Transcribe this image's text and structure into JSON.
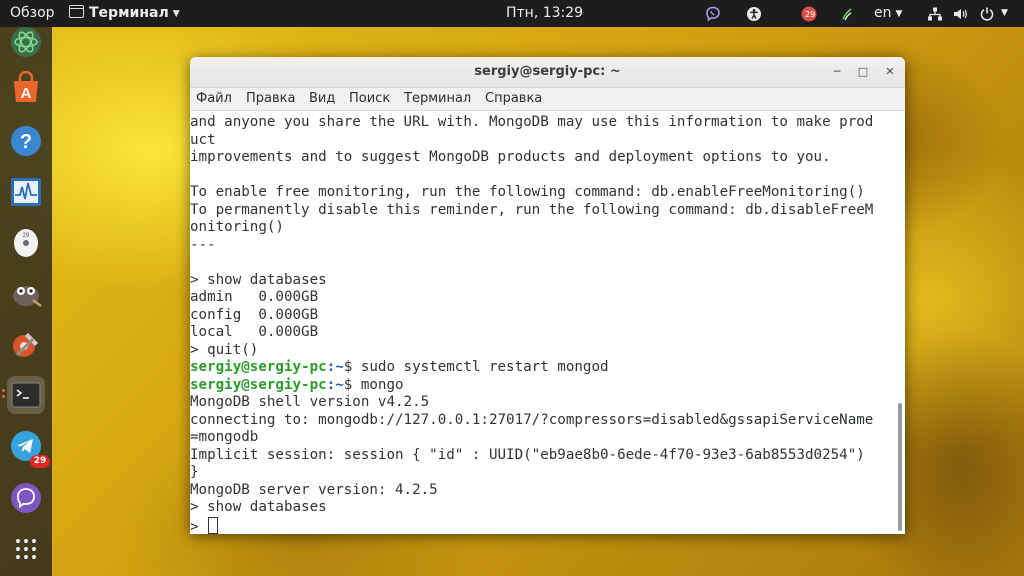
{
  "topbar": {
    "overview": "Обзор",
    "app_menu": "Терминал",
    "clock": "Птн, 13:29",
    "viber_badge": "29",
    "language": "en",
    "icons": [
      "viber-icon",
      "accessibility-icon",
      "telegram-icon",
      "sync-icon",
      "network-icon",
      "volume-icon",
      "power-icon"
    ]
  },
  "dock": {
    "items": [
      "atom-icon",
      "ubuntu-software-icon",
      "help-icon",
      "system-monitor-icon",
      "disk-utility-icon",
      "gimp-icon",
      "settings-icon",
      "terminal-icon",
      "telegram-icon",
      "viber-icon",
      "show-apps-icon"
    ],
    "telegram_badge": "29"
  },
  "window": {
    "title": "sergiy@sergiy-pc: ~",
    "menu": [
      "Файл",
      "Правка",
      "Вид",
      "Поиск",
      "Терминал",
      "Справка"
    ]
  },
  "terminal": {
    "lines": [
      {
        "text": "and anyone you share the URL with. MongoDB may use this information to make prod"
      },
      {
        "text": "uct"
      },
      {
        "text": "improvements and to suggest MongoDB products and deployment options to you."
      },
      {
        "text": ""
      },
      {
        "text": "To enable free monitoring, run the following command: db.enableFreeMonitoring()"
      },
      {
        "text": "To permanently disable this reminder, run the following command: db.disableFreeM"
      },
      {
        "text": "onitoring()"
      },
      {
        "text": "---"
      },
      {
        "text": ""
      },
      {
        "text": "> show databases"
      },
      {
        "text": "admin   0.000GB"
      },
      {
        "text": "config  0.000GB"
      },
      {
        "text": "local   0.000GB"
      },
      {
        "text": "> quit()"
      },
      {
        "prompt_user": "sergiy@sergiy-pc",
        "prompt_path": ":~",
        "text": "$ sudo systemctl restart mongod"
      },
      {
        "prompt_user": "sergiy@sergiy-pc",
        "prompt_path": ":~",
        "text": "$ mongo"
      },
      {
        "text": "MongoDB shell version v4.2.5"
      },
      {
        "text": "connecting to: mongodb://127.0.0.1:27017/?compressors=disabled&gssapiServiceName"
      },
      {
        "text": "=mongodb"
      },
      {
        "text": "Implicit session: session { \"id\" : UUID(\"eb9ae8b0-6ede-4f70-93e3-6ab8553d0254\")"
      },
      {
        "text": "}"
      },
      {
        "text": "MongoDB server version: 4.2.5"
      },
      {
        "text": "> show databases"
      },
      {
        "text": "> "
      }
    ]
  }
}
